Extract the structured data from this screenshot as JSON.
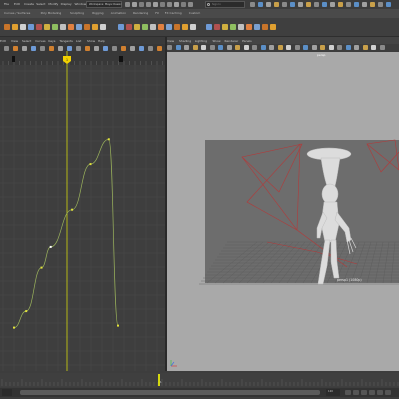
{
  "menu_bar": {
    "items": [
      "File",
      "Edit",
      "Create",
      "Select",
      "Modify",
      "Display",
      "Windows",
      "Mesh",
      "Edit Mesh",
      "Mesh Tools",
      "Mesh Display",
      "Curves",
      "Surfaces",
      "Deform",
      "UV",
      "Generate",
      "Cache",
      "Arnold",
      "Help"
    ],
    "workspace_value": "Workspace: Maya Classic",
    "search_placeholder": "Sign In"
  },
  "shelf": {
    "tabs": [
      "Curves / Surfaces",
      "Poly Modeling",
      "Sculpting",
      "Rigging",
      "Animation",
      "Rendering",
      "FX",
      "FX Caching",
      "Custom"
    ]
  },
  "graph_editor": {
    "menu_items": [
      "Edit",
      "View",
      "Select",
      "Curves",
      "Keys",
      "Tangents",
      "List",
      "Show",
      "Help"
    ],
    "current_frame_marker": "1",
    "keys": [
      {
        "frame": 0,
        "value": 0.05
      },
      {
        "frame": 4,
        "value": 0.13
      },
      {
        "frame": 9,
        "value": 0.34
      },
      {
        "frame": 12,
        "value": 0.44
      },
      {
        "frame": 19,
        "value": 0.62
      },
      {
        "frame": 25,
        "value": 0.84
      },
      {
        "frame": 31,
        "value": 0.96
      },
      {
        "frame": 34,
        "value": 0.06
      }
    ]
  },
  "viewport": {
    "menu_items": [
      "View",
      "Shading",
      "Lighting",
      "Show",
      "Renderer",
      "Panels"
    ],
    "camera_label": "persp",
    "fps_label": "persp1 (1080p)"
  },
  "time_slider": {
    "current_frame": "1",
    "range_end": "120"
  }
}
